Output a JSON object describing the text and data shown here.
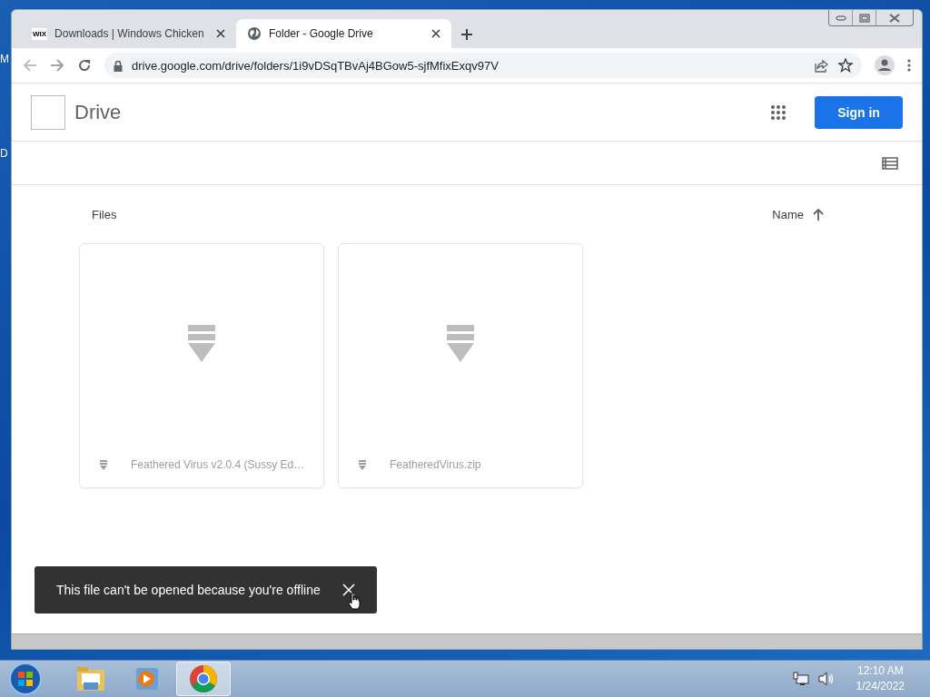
{
  "desktop": {
    "icon_labels": [
      "M",
      "D"
    ]
  },
  "browser": {
    "tabs": [
      {
        "kind": "wix",
        "favicon_text": "WIX",
        "title": "Downloads | Windows Chicken",
        "selected": false
      },
      {
        "kind": "globe",
        "title": "Folder - Google Drive",
        "selected": true
      }
    ],
    "address": "drive.google.com/drive/folders/1i9vDSqTBvAj4BGow5-sjfMfixExqv97V"
  },
  "page": {
    "app_name": "Drive",
    "sign_in": "Sign in",
    "section_title": "Files",
    "sort_label": "Name",
    "files": [
      {
        "name": "Feathered Virus v2.0.4 (Sussy Ed…"
      },
      {
        "name": "FeatheredVirus.zip"
      }
    ],
    "toast": {
      "message": "This file can't be opened because you're offline"
    }
  },
  "taskbar": {
    "apps": [
      {
        "kind": "explorer",
        "selected": false
      },
      {
        "kind": "media",
        "selected": false
      },
      {
        "kind": "chrome",
        "selected": true
      }
    ],
    "time": "12:10 AM",
    "date": "1/24/2022"
  }
}
